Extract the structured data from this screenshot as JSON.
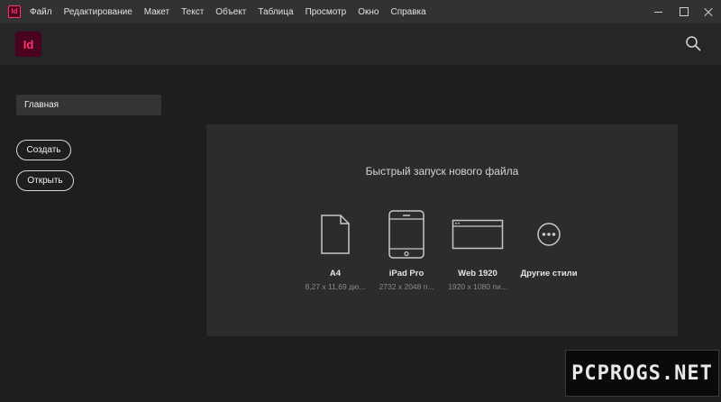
{
  "app": {
    "icon_letters": "Id",
    "logo_letters": "Id",
    "accent_color": "#ff3366",
    "logo_bg": "#49021f"
  },
  "menu": [
    "Файл",
    "Редактирование",
    "Макет",
    "Текст",
    "Объект",
    "Таблица",
    "Просмотр",
    "Окно",
    "Справка"
  ],
  "window_controls": {
    "minimize_icon": "minimize-icon",
    "maximize_icon": "maximize-icon",
    "close_icon": "close-icon"
  },
  "header": {
    "search_icon": "search-icon"
  },
  "sidebar": {
    "home_label": "Главная",
    "create_label": "Создать",
    "open_label": "Открыть"
  },
  "quick_start": {
    "title": "Быстрый запуск нового файла",
    "presets": [
      {
        "name": "A4",
        "size": "8,27 x 11,69 дю...",
        "icon": "document-icon"
      },
      {
        "name": "iPad Pro",
        "size": "2732 x 2048 п...",
        "icon": "tablet-icon"
      },
      {
        "name": "Web 1920",
        "size": "1920 x 1080 пи...",
        "icon": "browser-window-icon"
      },
      {
        "name": "Другие стили",
        "size": "",
        "icon": "more-icon"
      }
    ]
  },
  "watermark": "PCPROGS.NET"
}
